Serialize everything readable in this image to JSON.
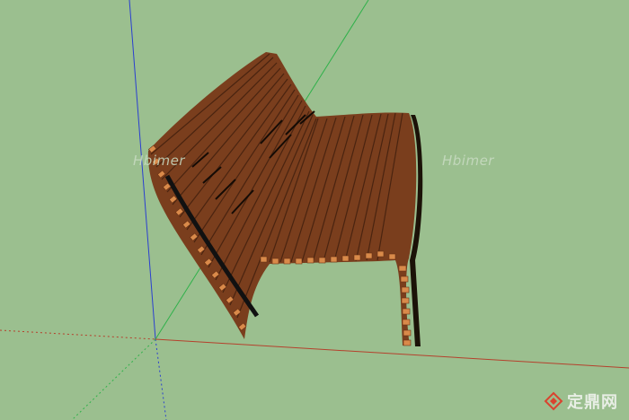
{
  "viewport": {
    "background": "#9bbf8f",
    "axis_colors": {
      "blue": "#2a3fd0",
      "green": "#2fb14a",
      "red": "#b5402c"
    },
    "model": "wooden slatted bench",
    "wood_color": "#7a3e1d",
    "slat_end_color": "#d98a4a"
  },
  "watermarks": {
    "left": "Hbimer",
    "right": "Hbimer"
  },
  "brand": {
    "logo_icon": "diamond-logo-icon",
    "text": "定鼎网"
  }
}
